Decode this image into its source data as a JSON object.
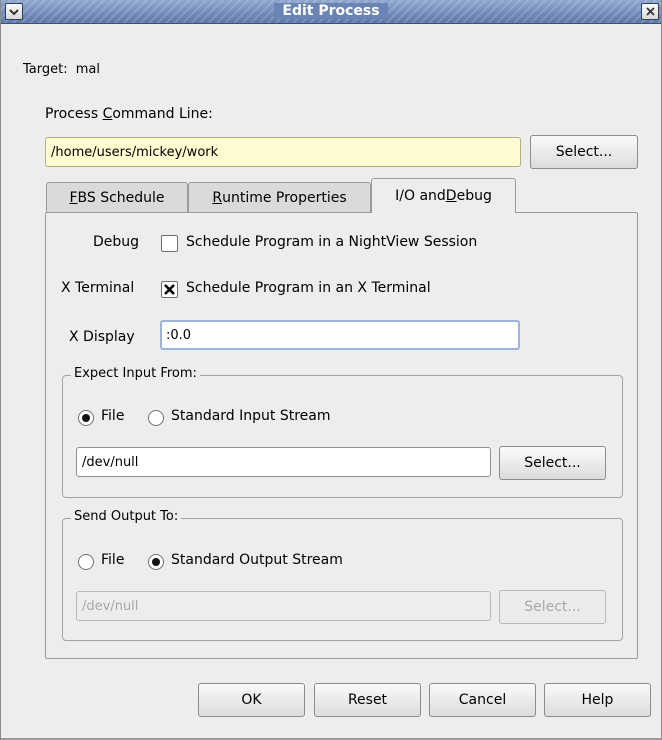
{
  "window": {
    "title": "Edit Process",
    "menu_icon": "chevron-down-icon",
    "close_icon": "close-icon"
  },
  "target": {
    "label": "Target:",
    "value": "mal"
  },
  "command_line": {
    "label_pre": "Process ",
    "label_mnemonic": "C",
    "label_post": "ommand Line:",
    "value": "/home/users/mickey/work",
    "select_label": "Select..."
  },
  "tabs": [
    {
      "mnemonic": "F",
      "rest": "BS Schedule"
    },
    {
      "mnemonic": "R",
      "rest": "untime Properties"
    },
    {
      "pre": "I/O and ",
      "mnemonic": "D",
      "rest": "ebug",
      "active": true
    }
  ],
  "io_debug": {
    "debug_label": "Debug",
    "debug_checkbox_label": "Schedule Program in a NightView Session",
    "debug_checked": false,
    "xterm_label": "X Terminal",
    "xterm_checkbox_label": "Schedule Program in an X Terminal",
    "xterm_checked": true,
    "xdisplay_label": "X Display",
    "xdisplay_value": ":0.0",
    "input_group": {
      "title": "Expect Input From:",
      "file_label": "File",
      "stream_label": "Standard Input Stream",
      "selected": "File",
      "path": "/dev/null",
      "select_label": "Select..."
    },
    "output_group": {
      "title": "Send Output To:",
      "file_label": "File",
      "stream_label": "Standard Output Stream",
      "selected": "Standard Output Stream",
      "path": "/dev/null",
      "select_label": "Select..."
    }
  },
  "buttons": {
    "ok": "OK",
    "reset": "Reset",
    "cancel": "Cancel",
    "help": "Help"
  }
}
